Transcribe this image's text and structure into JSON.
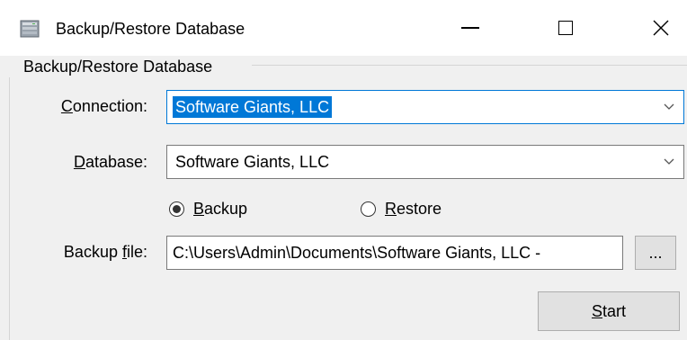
{
  "window": {
    "title": "Backup/Restore Database",
    "icon": "database-backup-icon",
    "controls": {
      "minimize": "minimize-icon",
      "maximize": "maximize-icon",
      "close_symbol": "✕"
    }
  },
  "group": {
    "title": "Backup/Restore Database"
  },
  "connection": {
    "label_accel": "C",
    "label_rest": "onnection:",
    "value": "Software Giants, LLC",
    "arrow_icon": "chevron-down-icon"
  },
  "database": {
    "label_accel": "D",
    "label_rest": "atabase:",
    "value": "Software Giants, LLC",
    "arrow_icon": "chevron-down-icon"
  },
  "mode": {
    "backup_accel": "B",
    "backup_rest": "ackup",
    "restore_accel": "R",
    "restore_rest": "estore",
    "selected": "Backup"
  },
  "backup_file": {
    "label_pre": "Backup ",
    "label_accel": "f",
    "label_rest": "ile:",
    "value": "C:\\Users\\Admin\\Documents\\Software Giants, LLC - ",
    "browse_label": "..."
  },
  "start_button": {
    "accel": "S",
    "rest": "tart"
  }
}
